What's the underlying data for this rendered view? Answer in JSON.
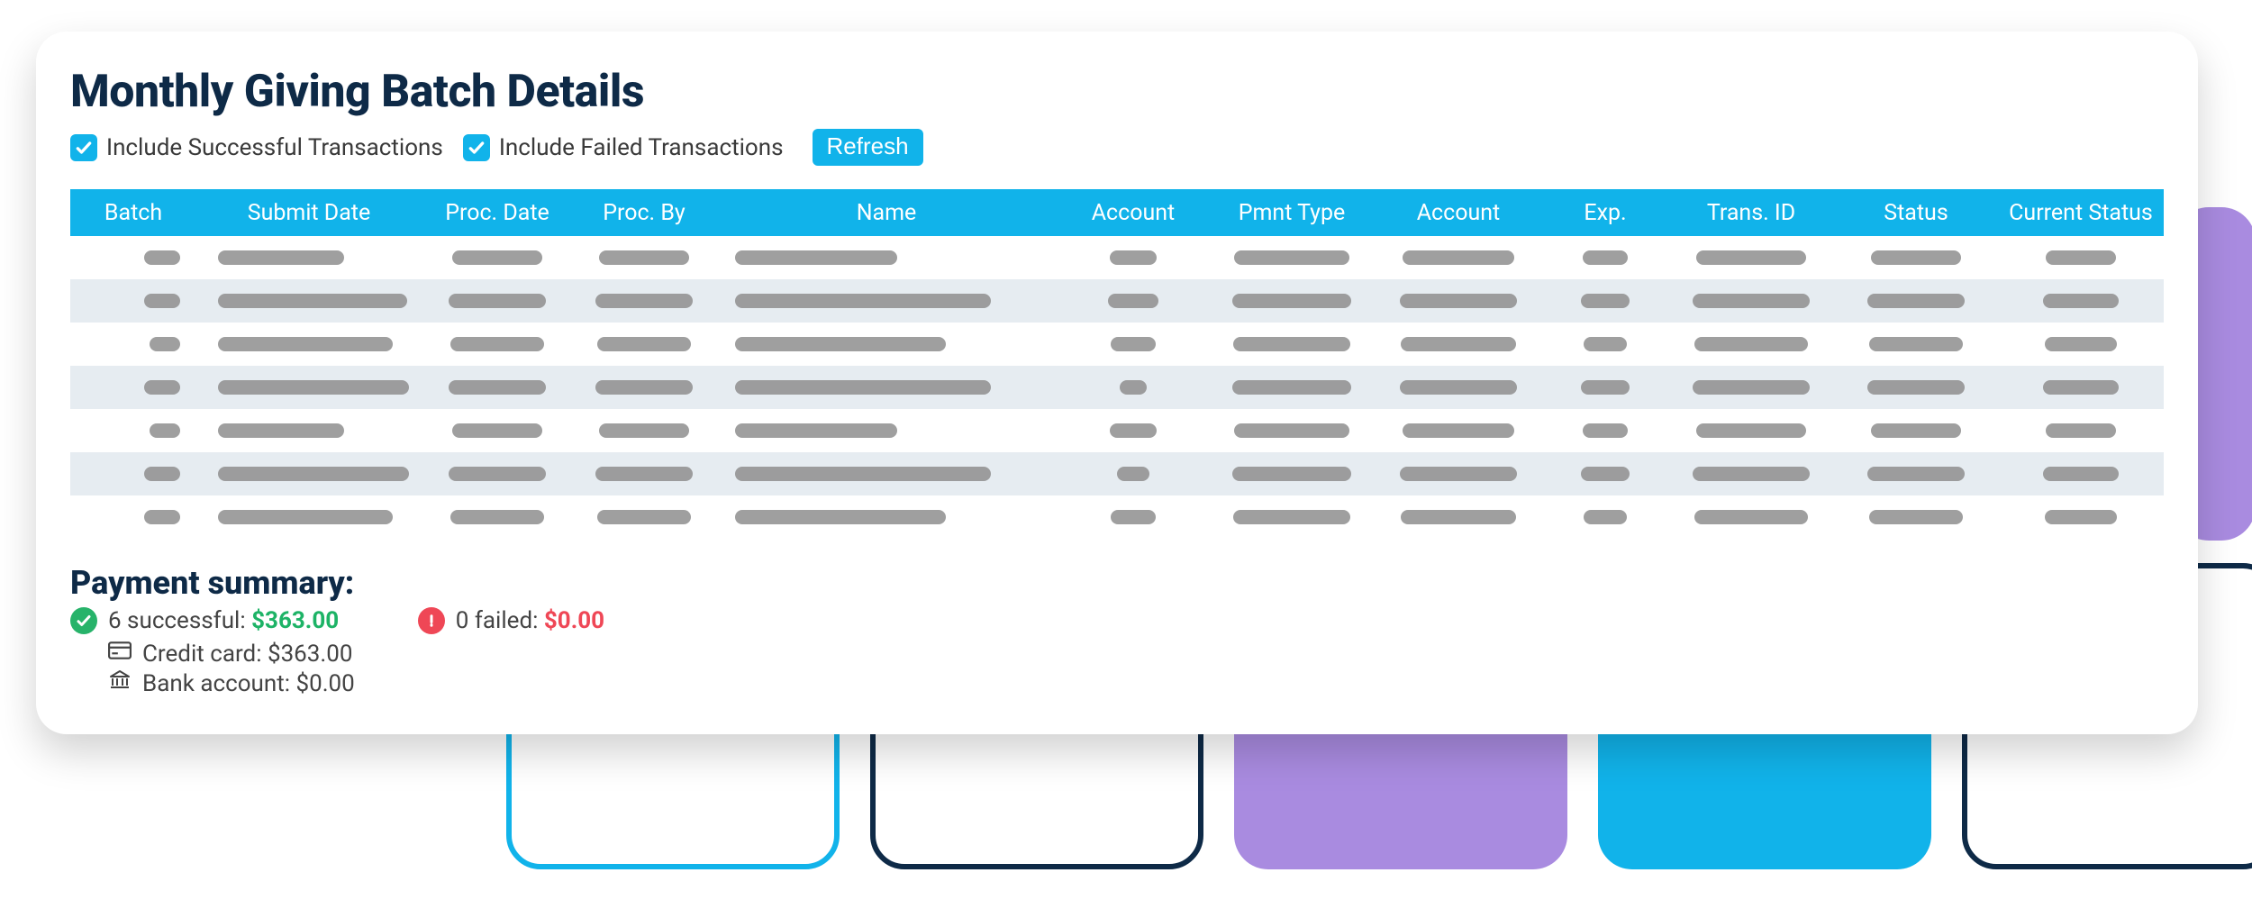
{
  "page": {
    "title": "Monthly Giving Batch Details"
  },
  "filters": {
    "include_success": {
      "checked": true,
      "label": "Include Successful Transactions"
    },
    "include_failed": {
      "checked": true,
      "label": "Include Failed Transactions"
    },
    "refresh_label": "Refresh"
  },
  "table": {
    "columns": [
      "Batch",
      "Submit Date",
      "Proc. Date",
      "Proc. By",
      "Name",
      "Account",
      "Pmnt Type",
      "Account",
      "Exp.",
      "Trans. ID",
      "Status",
      "Current Status"
    ],
    "row_count": 7
  },
  "summary": {
    "title": "Payment summary:",
    "successful": {
      "count_label": "6 successful: ",
      "amount": "$363.00"
    },
    "failed": {
      "count_label": "0 failed: ",
      "amount": "$0.00"
    },
    "credit_card": {
      "label": "Credit card: ",
      "amount": "$363.00"
    },
    "bank_account": {
      "label": "Bank account: ",
      "amount": "$0.00"
    }
  },
  "colors": {
    "accent": "#11b3ea",
    "navy": "#0e2a47",
    "purple": "#a98be0",
    "green": "#1db366",
    "red": "#ef4756"
  }
}
